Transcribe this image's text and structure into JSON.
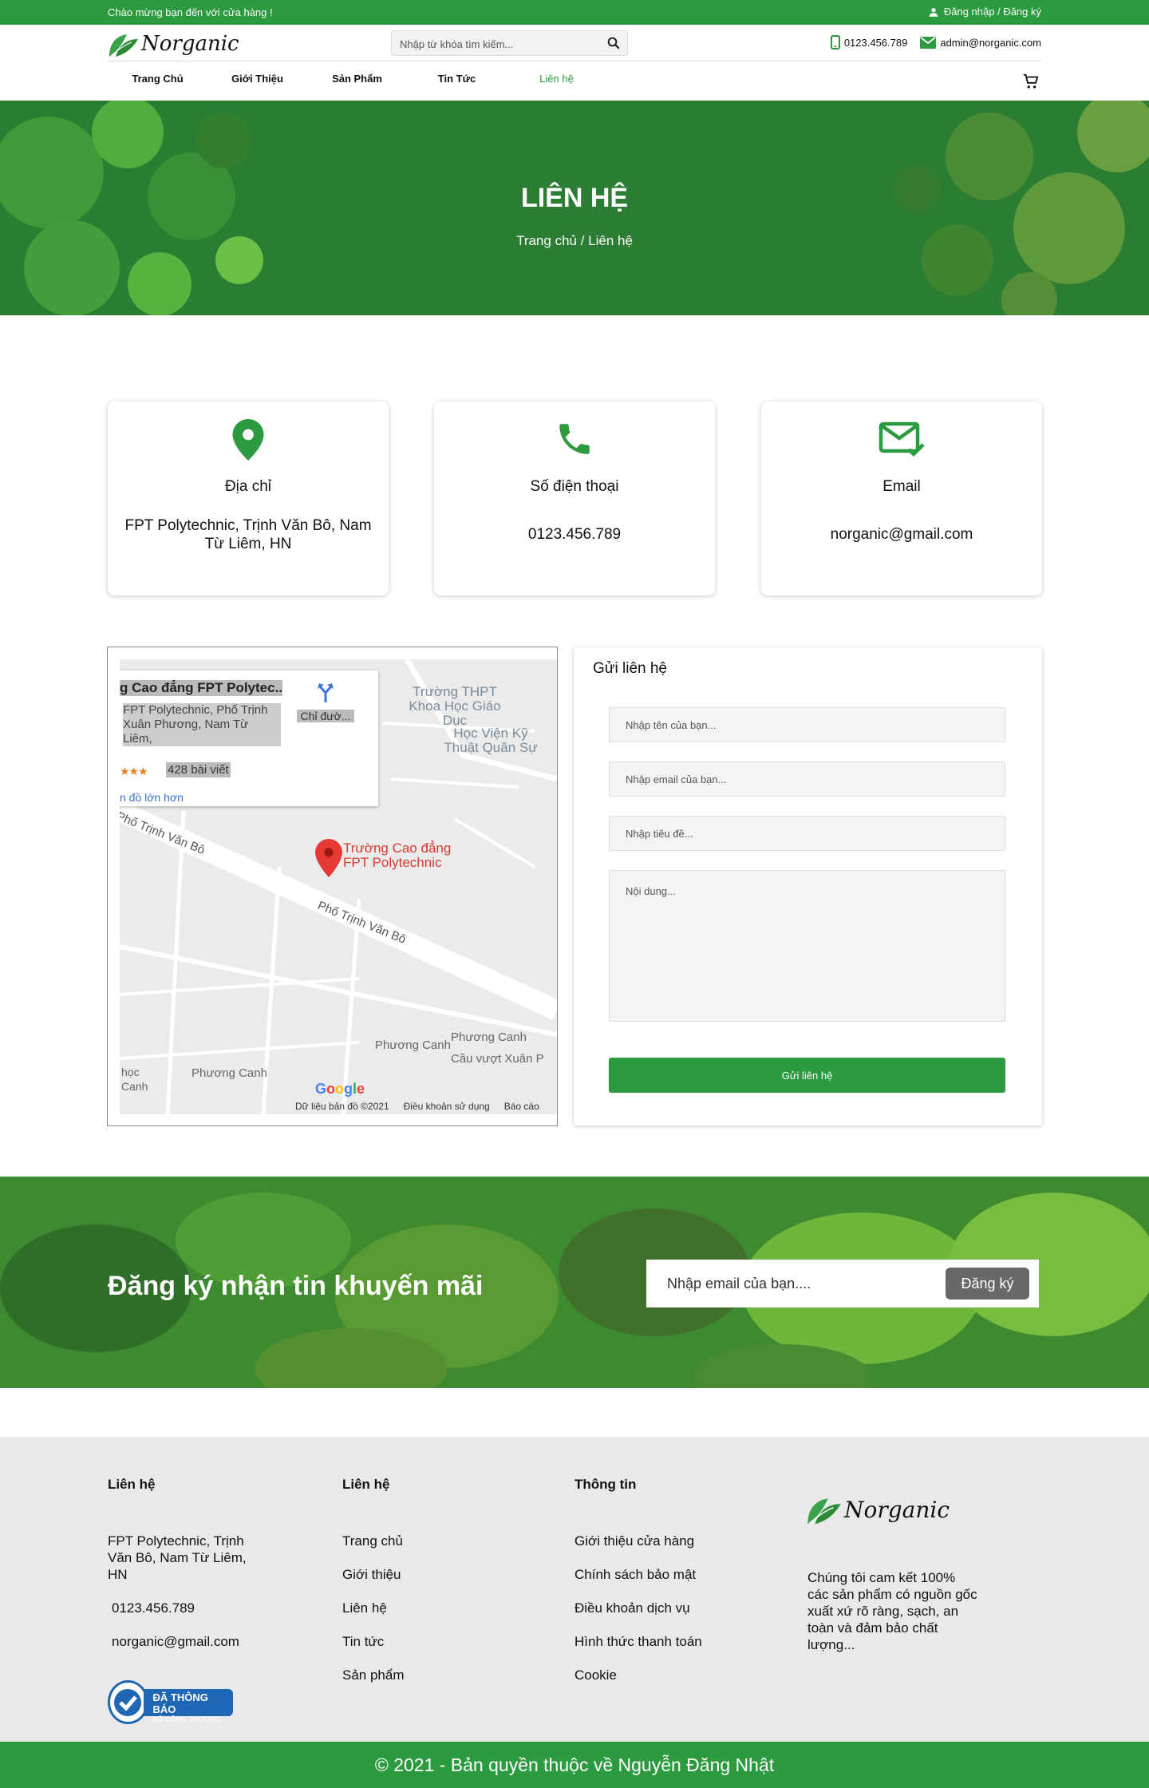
{
  "topbar": {
    "welcome": "Chào mừng bạn đến với cửa hàng !",
    "login": "Đăng nhập / Đăng ký"
  },
  "header": {
    "logo_text": "Norganic",
    "search_placeholder": "Nhập từ khóa tìm kiếm...",
    "phone": "0123.456.789",
    "email": "admin@norganic.com"
  },
  "nav": [
    "Trang Chủ",
    "Giới Thiệu",
    "Sản Phẩm",
    "Tin Tức",
    "Liên hệ"
  ],
  "hero": {
    "title": "LIÊN HỆ",
    "breadcrumb": "Trang chủ / Liên hệ"
  },
  "cards": [
    {
      "icon": "location-pin-icon",
      "label": "Địa chỉ",
      "value": "FPT Polytechnic, Trịnh Văn Bô, Nam Từ Liêm, HN"
    },
    {
      "icon": "phone-icon",
      "label": "Số điện thoại",
      "value": "0123.456.789"
    },
    {
      "icon": "mail-check-icon",
      "label": "Email",
      "value": "norganic@gmail.com"
    }
  ],
  "map": {
    "place_title": "g Cao đẳng FPT Polytec...",
    "place_address": "FPT Polytechnic, Phố Trịnh Xuân Phương, Nam Từ Liêm,",
    "directions": "Chỉ đườ...",
    "stars": "★★★",
    "reviews": "428 bài viết",
    "larger_map": "n đồ lớn hơn",
    "labels": {
      "school1": "Trường THPT Khoa Học Giáo Dục",
      "school2": "Học Viện Kỹ Thuật Quân Sự",
      "pin": "Trường Cao đẳng FPT Polytechnic",
      "street1": "Phố Trịnh Văn Bô",
      "street2": "Phố Trịnh Văn Bô",
      "area1": "Phương Canh",
      "area2": "Phương Canh",
      "area3": "Phương Canh",
      "bridge": "Cầu vượt Xuân P",
      "hoc": "học Canh"
    },
    "google": "Google",
    "footer": [
      "Dữ liệu bản đồ ©2021",
      "Điều khoản sử dụng",
      "Báo cáo"
    ]
  },
  "form": {
    "title": "Gửi liên hệ",
    "name_placeholder": "Nhập tên của bạn...",
    "email_placeholder": "Nhập email của bạn...",
    "subject_placeholder": "Nhập tiêu đề...",
    "content_placeholder": "Nội dung...",
    "submit": "Gửi liên hệ"
  },
  "newsletter": {
    "title": "Đăng ký nhận tin khuyến mãi",
    "placeholder": "Nhập email của bạn....",
    "button": "Đăng ký"
  },
  "footer": {
    "col1": {
      "heading": "Liên hệ",
      "address": "FPT Polytechnic, Trịnh Văn Bô, Nam Từ Liêm, HN",
      "phone": "0123.456.789",
      "email": "norganic@gmail.com"
    },
    "col2": {
      "heading": "Liên hệ",
      "links": [
        "Trang chủ",
        "Giới thiệu",
        "Liên hệ",
        "Tin tức",
        "Sản phẩm"
      ]
    },
    "col3": {
      "heading": "Thông tin",
      "links": [
        "Giới thiệu cửa hàng",
        "Chính sách bảo mật",
        "Điều khoản dịch vụ",
        "Hình thức thanh toán",
        "Cookie"
      ]
    },
    "logo_text": "Norganic",
    "description": "Chúng tôi cam kết 100% các sản phẩm có nguồn gốc xuất xứ rõ ràng, sạch, an toàn và đảm bảo chất lượng...",
    "badge_title": "ĐÃ THÔNG BÁO",
    "badge_sub": "BỘ CÔNG THƯƠNG"
  },
  "copyright": "© 2021 - Bản quyền thuộc về Nguyễn Đăng Nhật",
  "colors": {
    "brand": "#2c9a3f",
    "newsletter_button": "#686868",
    "footer_bg": "#e9e9e9"
  }
}
